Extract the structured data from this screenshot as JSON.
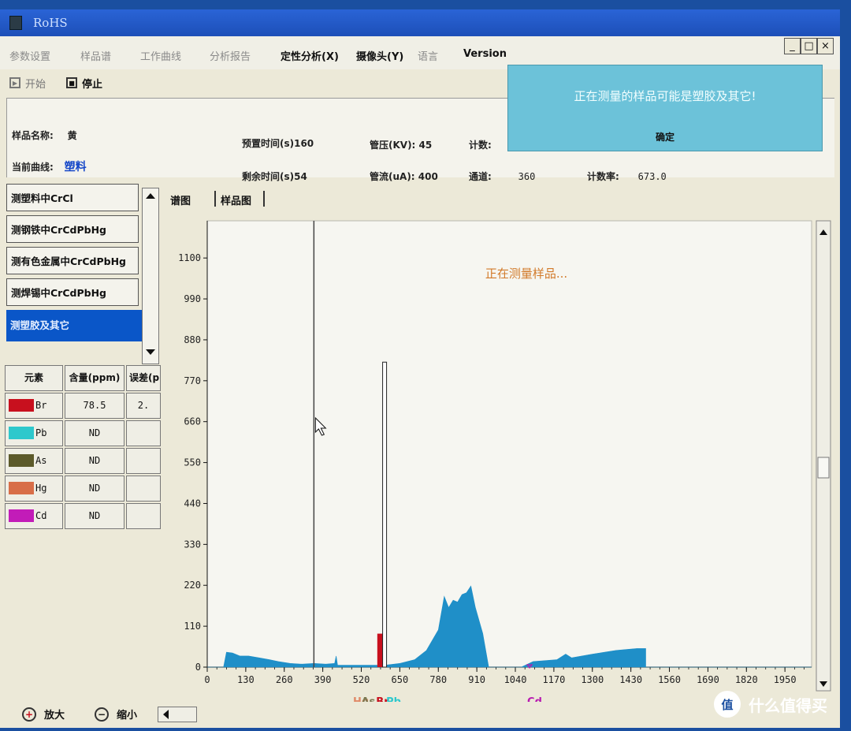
{
  "window": {
    "title": "RoHS"
  },
  "menu": [
    {
      "label": "参数设置",
      "active": false
    },
    {
      "label": "样品谱",
      "active": false
    },
    {
      "label": "工作曲线",
      "active": false
    },
    {
      "label": "分析报告",
      "active": false
    },
    {
      "label": "定性分析(X)",
      "active": true
    },
    {
      "label": "摄像头(Y)",
      "active": true
    },
    {
      "label": "语言",
      "active": false
    },
    {
      "label": "Version",
      "active": true
    }
  ],
  "window_controls": {
    "minimize": "_",
    "maximize": "□",
    "close": "×"
  },
  "toolbar": {
    "start_label": "开始",
    "stop_label": "停止"
  },
  "info": {
    "sample_name_label": "样品名称:",
    "sample_name_value": "黄",
    "curve_label": "当前曲线:",
    "curve_value": "塑料",
    "preset_time": "预置时间(s)160",
    "remaining_time": "剩余时间(s)54",
    "voltage": "管压(KV): 45",
    "current": "管流(uA): 400",
    "count_label": "计数:",
    "channel_label": "通道:",
    "channel_value": "360",
    "count_rate_label": "计数率:",
    "count_rate_value": "673.0"
  },
  "popup": {
    "message": "正在测量的样品可能是塑胶及其它!",
    "ok_label": "确定"
  },
  "curve_list": [
    "测塑料中CrCl",
    "测钢铁中CrCdPbHg",
    "测有色金属中CrCdPbHg",
    "测焊锡中CrCdPbHg",
    "测塑胶及其它"
  ],
  "curve_list_selected": 4,
  "element_table": {
    "headers": [
      "元素",
      "含量(ppm)",
      "误差(p"
    ],
    "rows": [
      {
        "element": "Br",
        "content": "78.5",
        "error": "2.",
        "color": "#c8101e"
      },
      {
        "element": "Pb",
        "content": "ND",
        "error": "",
        "color": "#2ec8cc"
      },
      {
        "element": "As",
        "content": "ND",
        "error": "",
        "color": "#5c5a2a"
      },
      {
        "element": "Hg",
        "content": "ND",
        "error": "",
        "color": "#d86e48"
      },
      {
        "element": "Cd",
        "content": "ND",
        "error": "",
        "color": "#c21cb8"
      }
    ]
  },
  "tabs": [
    "谱图",
    "样品图"
  ],
  "zoom": {
    "in_label": "放大",
    "out_label": "缩小"
  },
  "watermark": {
    "badge": "值",
    "text": "什么值得买"
  },
  "chart_data": {
    "type": "area",
    "title": "",
    "status_text": "正在测量样品...",
    "xlabel": "",
    "ylabel": "",
    "xlim": [
      0,
      2040
    ],
    "ylim": [
      0,
      1200
    ],
    "x_ticks": [
      0,
      130,
      260,
      390,
      520,
      650,
      780,
      910,
      1040,
      1170,
      1300,
      1430,
      1560,
      1690,
      1820,
      1950
    ],
    "y_ticks": [
      0,
      110,
      220,
      330,
      440,
      550,
      660,
      770,
      880,
      990,
      1100
    ],
    "cursor_x": 360,
    "peak_markers": [
      {
        "label": "Hg",
        "x": 492,
        "color": "#e08a68"
      },
      {
        "label": "As",
        "x": 520,
        "color": "#7a7850"
      },
      {
        "label": "Br",
        "x": 570,
        "color": "#c8101e"
      },
      {
        "label": "Pb",
        "x": 604,
        "color": "#2ec8cc"
      },
      {
        "label": "Cd",
        "x": 1080,
        "color": "#b81cb0"
      }
    ],
    "spectrum": {
      "color": "#1f8fc8",
      "points": [
        [
          0,
          0
        ],
        [
          55,
          0
        ],
        [
          65,
          40
        ],
        [
          85,
          38
        ],
        [
          110,
          30
        ],
        [
          140,
          30
        ],
        [
          175,
          25
        ],
        [
          210,
          20
        ],
        [
          240,
          15
        ],
        [
          280,
          10
        ],
        [
          320,
          8
        ],
        [
          360,
          10
        ],
        [
          400,
          8
        ],
        [
          430,
          10
        ],
        [
          435,
          30
        ],
        [
          440,
          5
        ],
        [
          480,
          5
        ],
        [
          550,
          5
        ],
        [
          600,
          5
        ],
        [
          650,
          10
        ],
        [
          700,
          20
        ],
        [
          740,
          45
        ],
        [
          780,
          100
        ],
        [
          800,
          190
        ],
        [
          815,
          160
        ],
        [
          830,
          180
        ],
        [
          845,
          175
        ],
        [
          860,
          195
        ],
        [
          875,
          200
        ],
        [
          890,
          218
        ],
        [
          905,
          160
        ],
        [
          930,
          90
        ],
        [
          950,
          0
        ],
        [
          1060,
          0
        ],
        [
          1100,
          15
        ],
        [
          1180,
          20
        ],
        [
          1210,
          35
        ],
        [
          1230,
          25
        ],
        [
          1300,
          35
        ],
        [
          1380,
          45
        ],
        [
          1450,
          50
        ],
        [
          1480,
          50
        ],
        [
          1480,
          0
        ],
        [
          2040,
          0
        ]
      ]
    },
    "peaks": [
      {
        "element": "Br",
        "x": 590,
        "y": 90,
        "color": "#c8101e"
      },
      {
        "element": "sample_line",
        "x": 600,
        "y": 820,
        "color": "#222222"
      }
    ]
  }
}
